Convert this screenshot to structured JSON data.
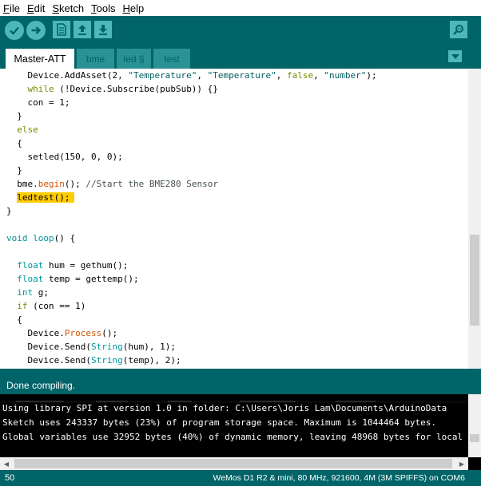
{
  "menu": {
    "items": [
      {
        "key": "F",
        "rest": "ile"
      },
      {
        "key": "E",
        "rest": "dit"
      },
      {
        "key": "S",
        "rest": "ketch"
      },
      {
        "key": "T",
        "rest": "ools"
      },
      {
        "key": "H",
        "rest": "elp"
      }
    ]
  },
  "toolbar": {
    "buttons": [
      "verify-icon",
      "upload-icon",
      "new-icon",
      "open-icon",
      "save-icon",
      "serial-monitor-icon"
    ]
  },
  "tabs": [
    {
      "label": "Master-ATT",
      "active": true
    },
    {
      "label": "bme",
      "active": false
    },
    {
      "label": "led §",
      "active": false
    },
    {
      "label": "test",
      "active": false
    }
  ],
  "editor": {
    "lines": [
      [
        [
          "plain",
          "    Device.AddAsset(2, "
        ],
        [
          "str",
          "\"Temperature\""
        ],
        [
          "plain",
          ", "
        ],
        [
          "str",
          "\"Temperature\""
        ],
        [
          "plain",
          ", "
        ],
        [
          "kw",
          "false"
        ],
        [
          "plain",
          ", "
        ],
        [
          "str",
          "\"number\""
        ],
        [
          "plain",
          ");"
        ]
      ],
      [
        [
          "plain",
          "    "
        ],
        [
          "kw",
          "while"
        ],
        [
          "plain",
          " (!Device.Subscribe(pubSub)) {}"
        ]
      ],
      [
        [
          "plain",
          "    con = 1;"
        ]
      ],
      [
        [
          "plain",
          "  }"
        ]
      ],
      [
        [
          "plain",
          "  "
        ],
        [
          "kw",
          "else"
        ]
      ],
      [
        [
          "plain",
          "  {"
        ]
      ],
      [
        [
          "plain",
          "    setled(150, 0, 0);"
        ]
      ],
      [
        [
          "plain",
          "  }"
        ]
      ],
      [
        [
          "plain",
          "  bme."
        ],
        [
          "fn",
          "begin"
        ],
        [
          "plain",
          "(); "
        ],
        [
          "cmt",
          "//Start the BME280 Sensor"
        ]
      ],
      [
        [
          "hl",
          "  ledtest();"
        ]
      ],
      [
        [
          "plain",
          "}"
        ]
      ],
      [
        [
          "plain",
          ""
        ]
      ],
      [
        [
          "type",
          "void"
        ],
        [
          "plain",
          " "
        ],
        [
          "type",
          "loop"
        ],
        [
          "plain",
          "() {"
        ]
      ],
      [
        [
          "plain",
          ""
        ]
      ],
      [
        [
          "plain",
          "  "
        ],
        [
          "type",
          "float"
        ],
        [
          "plain",
          " hum = gethum();"
        ]
      ],
      [
        [
          "plain",
          "  "
        ],
        [
          "type",
          "float"
        ],
        [
          "plain",
          " temp = gettemp();"
        ]
      ],
      [
        [
          "plain",
          "  "
        ],
        [
          "type",
          "int"
        ],
        [
          "plain",
          " g;"
        ]
      ],
      [
        [
          "plain",
          "  "
        ],
        [
          "kw",
          "if"
        ],
        [
          "plain",
          " (con == 1)"
        ]
      ],
      [
        [
          "plain",
          "  {"
        ]
      ],
      [
        [
          "plain",
          "    Device."
        ],
        [
          "fn",
          "Process"
        ],
        [
          "plain",
          "();"
        ]
      ],
      [
        [
          "plain",
          "    Device.Send("
        ],
        [
          "type",
          "String"
        ],
        [
          "plain",
          "(hum), 1);"
        ]
      ],
      [
        [
          "plain",
          "    Device.Send("
        ],
        [
          "type",
          "String"
        ],
        [
          "plain",
          "(temp), 2);"
        ]
      ]
    ]
  },
  "status": {
    "message": "Done compiling."
  },
  "console": {
    "lines": [
      "Using library SPI at version 1.0 in folder: C:\\Users\\Joris Lam\\Documents\\ArduinoData",
      "Sketch uses 243337 bytes (23%) of program storage space. Maximum is 1044464 bytes.",
      "Global variables use 32952 bytes (40%) of dynamic memory, leaving 48968 bytes for local"
    ]
  },
  "bottombar": {
    "line_number": "50",
    "board_info": "WeMos D1 R2 & mini, 80 MHz, 921600, 4M (3M SPIFFS) on COM6"
  },
  "colors": {
    "teal_dark": "#006468",
    "teal_light": "#4db7bb",
    "highlight": "#ffcc00",
    "keyword": "#728e00",
    "type": "#00979c",
    "function": "#d35400"
  }
}
